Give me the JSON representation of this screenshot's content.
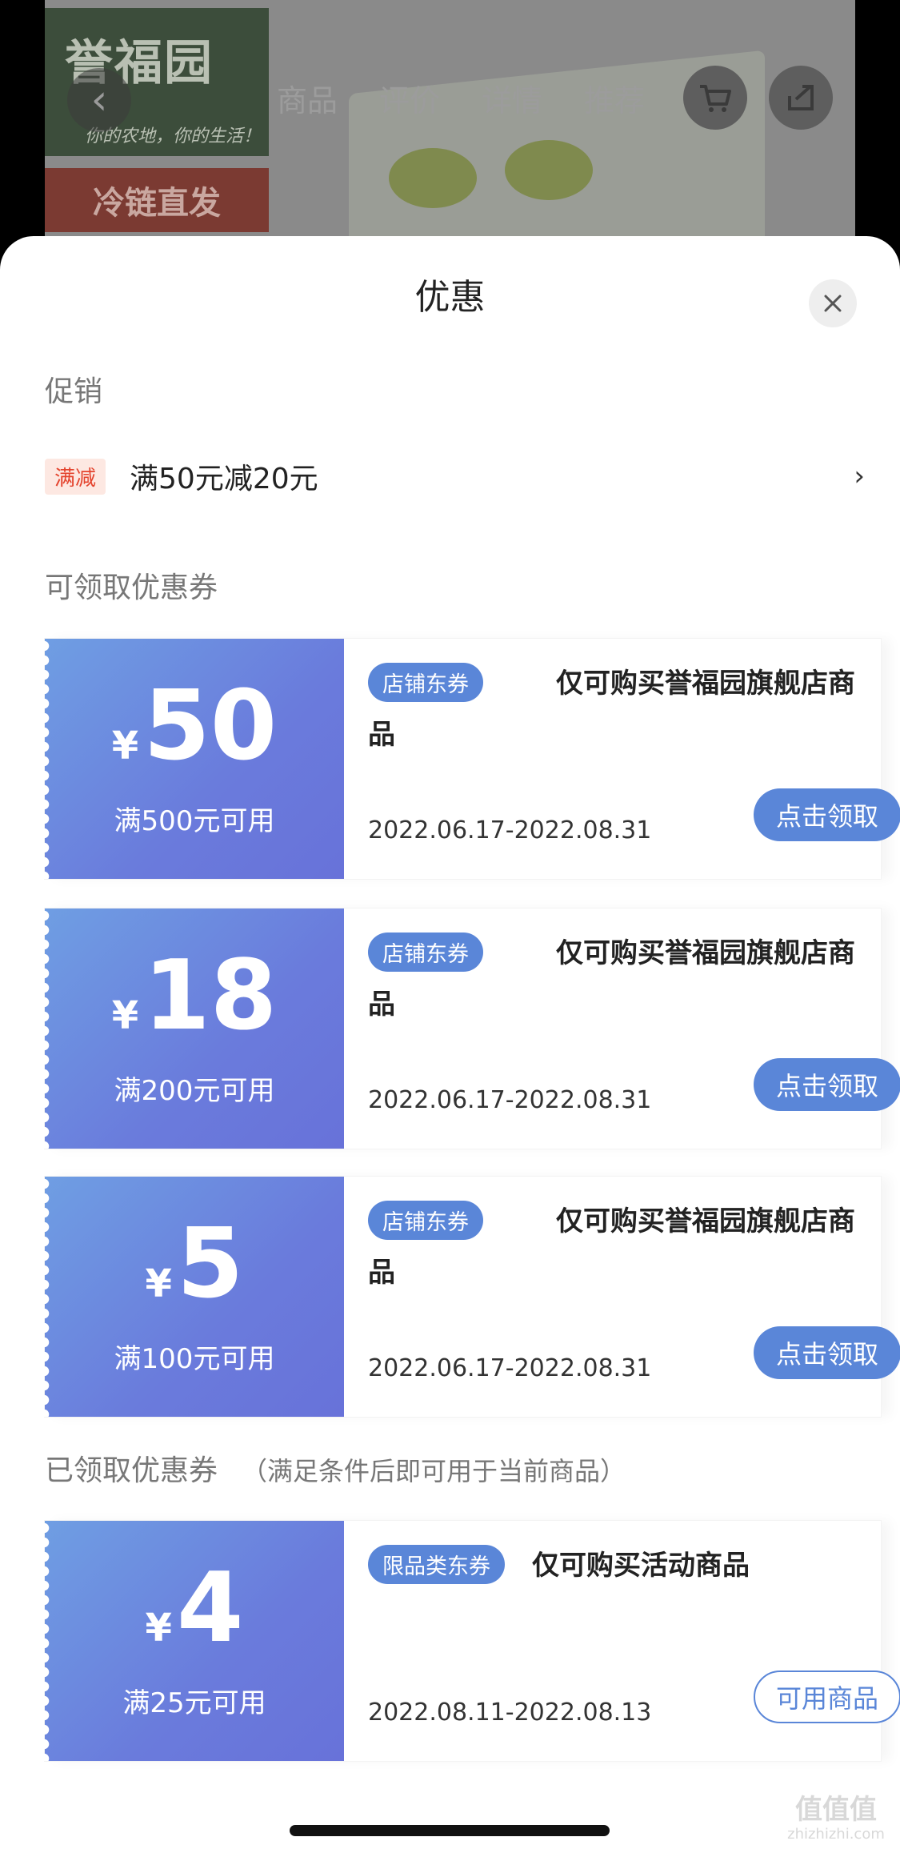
{
  "background_page": {
    "brand_name": "誉福园",
    "brand_slogan": "你的农地，你的生活！",
    "cold_chain_label": "冷链直发",
    "tabs": [
      "商品",
      "评价",
      "详情",
      "推荐"
    ]
  },
  "sheet": {
    "title": "优惠",
    "promotion_section_label": "促销",
    "promotion": {
      "tag": "满减",
      "text": "满50元减20元",
      "arrow": "›"
    },
    "available_section_label": "可领取优惠券",
    "available_coupons": [
      {
        "currency": "¥",
        "amount": "50",
        "condition": "满500元可用",
        "tag": "店铺东券",
        "title_line1": "仅可购买誉福园旗舰店商",
        "title_line2": "品",
        "date": "2022.06.17-2022.08.31",
        "button": "点击领取"
      },
      {
        "currency": "¥",
        "amount": "18",
        "condition": "满200元可用",
        "tag": "店铺东券",
        "title_line1": "仅可购买誉福园旗舰店商",
        "title_line2": "品",
        "date": "2022.06.17-2022.08.31",
        "button": "点击领取"
      },
      {
        "currency": "¥",
        "amount": "5",
        "condition": "满100元可用",
        "tag": "店铺东券",
        "title_line1": "仅可购买誉福园旗舰店商",
        "title_line2": "品",
        "date": "2022.06.17-2022.08.31",
        "button": "点击领取"
      }
    ],
    "claimed_section_label": "已领取优惠券",
    "claimed_section_hint": "（满足条件后即可用于当前商品）",
    "claimed_coupons": [
      {
        "currency": "¥",
        "amount": "4",
        "condition": "满25元可用",
        "tag": "限品类东券",
        "title_line1": "仅可购买活动商品",
        "title_line2": "",
        "date": "2022.08.11-2022.08.13",
        "button": "可用商品"
      }
    ]
  },
  "watermark": {
    "text": "值值值",
    "url": "zhizhizhi.com"
  },
  "colors": {
    "accent": "#5a86d8",
    "coupon_gradient_start": "#6f9ee3",
    "coupon_gradient_end": "#6872d9",
    "promo_tag": "#e4432d"
  }
}
